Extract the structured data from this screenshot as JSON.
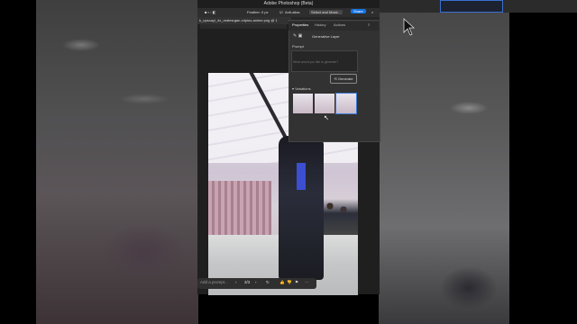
{
  "app": {
    "title": "Adobe Photoshop (Beta)"
  },
  "options_bar": {
    "feather_label": "Feather:",
    "feather_value": "0 px",
    "anti_alias_label": "Anti-alias",
    "select_mask_label": "Select and Mask...",
    "share_label": "Share"
  },
  "document": {
    "tab_name": "k_upscayl_4x_realesrgan-x4plus-anime.png @ 1"
  },
  "properties_panel": {
    "tabs": [
      "Properties",
      "History",
      "Actions"
    ],
    "layer_type": "Generative Layer",
    "prompt_label": "Prompt",
    "prompt_placeholder": "What would you like to generate?",
    "generate_label": "Generate",
    "variations_label": "Variations"
  },
  "context_bar": {
    "prompt_placeholder": "Add a prompt...",
    "page_indicator": "3/3"
  },
  "colors": {
    "accent": "#3a7bd5",
    "panel_bg": "#323232"
  }
}
